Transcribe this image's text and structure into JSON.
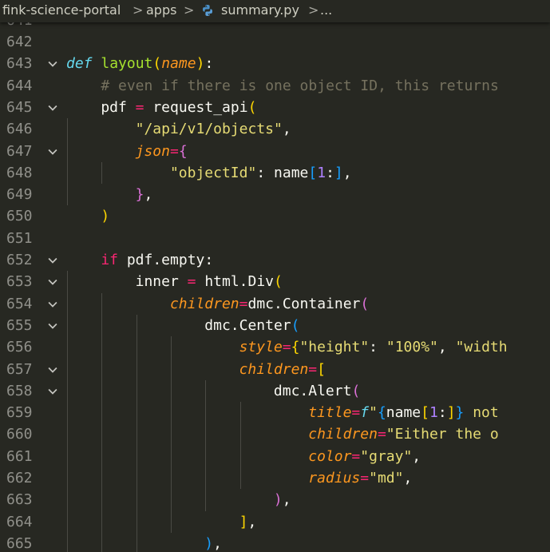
{
  "breadcrumb": {
    "items": [
      "fink-science-portal",
      "apps",
      "summary.py",
      "..."
    ],
    "separator": ">",
    "file_icon": "python-icon"
  },
  "editor": {
    "first_partial_line": "641",
    "lines": [
      {
        "n": "642",
        "fold": false,
        "indent": 0,
        "tokens": []
      },
      {
        "n": "643",
        "fold": true,
        "indent": 0,
        "tokens": [
          {
            "t": "def",
            "c": "kw"
          },
          {
            "t": " ",
            "c": "plain"
          },
          {
            "t": "layout",
            "c": "fn"
          },
          {
            "t": "(",
            "c": "b1"
          },
          {
            "t": "name",
            "c": "prm"
          },
          {
            "t": ")",
            "c": "b1"
          },
          {
            "t": ":",
            "c": "plain"
          }
        ]
      },
      {
        "n": "644",
        "fold": false,
        "indent": 1,
        "tokens": [
          {
            "t": "# even if there is one object ID, this returns",
            "c": "cm"
          }
        ]
      },
      {
        "n": "645",
        "fold": true,
        "indent": 1,
        "tokens": [
          {
            "t": "pdf",
            "c": "plain"
          },
          {
            "t": " = ",
            "c": "op"
          },
          {
            "t": "request_api",
            "c": "plain"
          },
          {
            "t": "(",
            "c": "b1"
          }
        ]
      },
      {
        "n": "646",
        "fold": false,
        "indent": 2,
        "tokens": [
          {
            "t": "\"/api/v1/objects\"",
            "c": "str"
          },
          {
            "t": ",",
            "c": "plain"
          }
        ]
      },
      {
        "n": "647",
        "fold": true,
        "indent": 2,
        "tokens": [
          {
            "t": "json",
            "c": "prm"
          },
          {
            "t": "=",
            "c": "op"
          },
          {
            "t": "{",
            "c": "b2"
          }
        ]
      },
      {
        "n": "648",
        "fold": false,
        "indent": 3,
        "tokens": [
          {
            "t": "\"objectId\"",
            "c": "str"
          },
          {
            "t": ": ",
            "c": "plain"
          },
          {
            "t": "name",
            "c": "plain"
          },
          {
            "t": "[",
            "c": "b3"
          },
          {
            "t": "1",
            "c": "num"
          },
          {
            "t": ":",
            "c": "plain"
          },
          {
            "t": "]",
            "c": "b3"
          },
          {
            "t": ",",
            "c": "plain"
          }
        ]
      },
      {
        "n": "649",
        "fold": false,
        "indent": 2,
        "tokens": [
          {
            "t": "}",
            "c": "b2"
          },
          {
            "t": ",",
            "c": "plain"
          }
        ]
      },
      {
        "n": "650",
        "fold": false,
        "indent": 1,
        "tokens": [
          {
            "t": ")",
            "c": "b1"
          }
        ]
      },
      {
        "n": "651",
        "fold": false,
        "indent": 0,
        "tokens": []
      },
      {
        "n": "652",
        "fold": true,
        "indent": 1,
        "tokens": [
          {
            "t": "if",
            "c": "op"
          },
          {
            "t": " pdf.empty:",
            "c": "plain"
          }
        ]
      },
      {
        "n": "653",
        "fold": true,
        "indent": 2,
        "tokens": [
          {
            "t": "inner",
            "c": "plain"
          },
          {
            "t": " = ",
            "c": "op"
          },
          {
            "t": "html.Div",
            "c": "plain"
          },
          {
            "t": "(",
            "c": "b1"
          }
        ]
      },
      {
        "n": "654",
        "fold": true,
        "indent": 3,
        "tokens": [
          {
            "t": "children",
            "c": "prm"
          },
          {
            "t": "=",
            "c": "op"
          },
          {
            "t": "dmc.Container",
            "c": "plain"
          },
          {
            "t": "(",
            "c": "b2"
          }
        ]
      },
      {
        "n": "655",
        "fold": true,
        "indent": 4,
        "tokens": [
          {
            "t": "dmc.Center",
            "c": "plain"
          },
          {
            "t": "(",
            "c": "b3"
          }
        ]
      },
      {
        "n": "656",
        "fold": false,
        "indent": 5,
        "tokens": [
          {
            "t": "style",
            "c": "prm"
          },
          {
            "t": "=",
            "c": "op"
          },
          {
            "t": "{",
            "c": "b1"
          },
          {
            "t": "\"height\"",
            "c": "str"
          },
          {
            "t": ": ",
            "c": "plain"
          },
          {
            "t": "\"100%\"",
            "c": "str"
          },
          {
            "t": ", ",
            "c": "plain"
          },
          {
            "t": "\"width",
            "c": "str"
          }
        ]
      },
      {
        "n": "657",
        "fold": true,
        "indent": 5,
        "tokens": [
          {
            "t": "children",
            "c": "prm"
          },
          {
            "t": "=",
            "c": "op"
          },
          {
            "t": "[",
            "c": "b1"
          }
        ]
      },
      {
        "n": "658",
        "fold": true,
        "indent": 6,
        "tokens": [
          {
            "t": "dmc.Alert",
            "c": "plain"
          },
          {
            "t": "(",
            "c": "b2"
          }
        ]
      },
      {
        "n": "659",
        "fold": false,
        "indent": 7,
        "tokens": [
          {
            "t": "title",
            "c": "prm"
          },
          {
            "t": "=",
            "c": "op"
          },
          {
            "t": "f",
            "c": "kw"
          },
          {
            "t": "\"",
            "c": "str"
          },
          {
            "t": "{",
            "c": "b3"
          },
          {
            "t": "name",
            "c": "plain"
          },
          {
            "t": "[",
            "c": "b1"
          },
          {
            "t": "1",
            "c": "num"
          },
          {
            "t": ":",
            "c": "plain"
          },
          {
            "t": "]",
            "c": "b1"
          },
          {
            "t": "}",
            "c": "b3"
          },
          {
            "t": " not",
            "c": "str"
          }
        ]
      },
      {
        "n": "660",
        "fold": false,
        "indent": 7,
        "tokens": [
          {
            "t": "children",
            "c": "prm"
          },
          {
            "t": "=",
            "c": "op"
          },
          {
            "t": "\"Either the o",
            "c": "str"
          }
        ]
      },
      {
        "n": "661",
        "fold": false,
        "indent": 7,
        "tokens": [
          {
            "t": "color",
            "c": "prm"
          },
          {
            "t": "=",
            "c": "op"
          },
          {
            "t": "\"gray\"",
            "c": "str"
          },
          {
            "t": ",",
            "c": "plain"
          }
        ]
      },
      {
        "n": "662",
        "fold": false,
        "indent": 7,
        "tokens": [
          {
            "t": "radius",
            "c": "prm"
          },
          {
            "t": "=",
            "c": "op"
          },
          {
            "t": "\"md\"",
            "c": "str"
          },
          {
            "t": ",",
            "c": "plain"
          }
        ]
      },
      {
        "n": "663",
        "fold": false,
        "indent": 6,
        "tokens": [
          {
            "t": ")",
            "c": "b2"
          },
          {
            "t": ",",
            "c": "plain"
          }
        ]
      },
      {
        "n": "664",
        "fold": false,
        "indent": 5,
        "tokens": [
          {
            "t": "]",
            "c": "b1"
          },
          {
            "t": ",",
            "c": "plain"
          }
        ]
      },
      {
        "n": "665",
        "fold": false,
        "indent": 4,
        "tokens": [
          {
            "t": ")",
            "c": "b3"
          },
          {
            "t": ",",
            "c": "plain"
          }
        ]
      }
    ]
  }
}
